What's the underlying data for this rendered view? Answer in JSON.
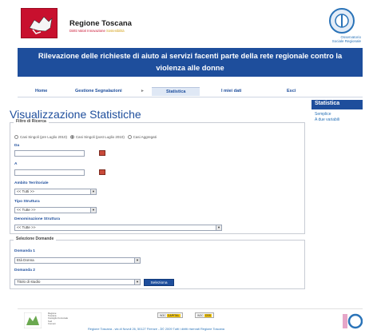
{
  "header": {
    "org_name": "Regione Toscana",
    "org_sub_a": "Diritti Valori Innovazione",
    "org_sub_b": "Sostenibilità",
    "osservatorio_1": "Osservatorio",
    "osservatorio_2": "Sociale Regionale"
  },
  "banner": {
    "line1": "Rilevazione delle richieste di aiuto ai servizi facenti parte della rete regionale contro la",
    "line2": "violenza alle donne"
  },
  "nav": {
    "home": "Home",
    "gestione": "Gestione Segnalazioni",
    "gestione_arrow": "▸",
    "statistica": "Statistica",
    "miei_dati": "I miei dati",
    "esci": "Esci"
  },
  "page": {
    "title": "Visualizzazione Statistiche"
  },
  "filtro": {
    "legend": "Filtro di Ricerca",
    "radio_1": "Casi Singoli (pre Luglio 2010)",
    "radio_2": "Casi Singoli (post Luglio 2010)",
    "radio_3": "Casi Aggregati",
    "da_label": "Da",
    "a_label": "A",
    "ambito_label": "Ambito Territoriale",
    "ambito_value": "<< Tutti >>",
    "tipo_label": "Tipo Struttura",
    "tipo_value": "<< Tutte >>",
    "denom_label": "Denominazione Struttura",
    "denom_value": "<< Tutte >>"
  },
  "selezione": {
    "legend": "Selezione Domande",
    "d1_label": "Domanda 1",
    "d1_value": "Età Donna",
    "d2_label": "Domanda 2",
    "d2_value": "Titolo di studio",
    "button": "Seleziona"
  },
  "sidebar": {
    "heading": "Statistica",
    "link_1": "Semplice",
    "link_2": "A due variabili"
  },
  "footer": {
    "logo_l1": "Regione",
    "logo_l2": "Toscana",
    "logo_l3": "Consiglio Comunale",
    "logo_l4": "Sud",
    "logo_l5": "Comuni",
    "badge_1": "CAPITAL",
    "badge_1_prefix": "W3C",
    "badge_2": "CSS",
    "badge_2_prefix": "W3C",
    "text": "Regione Toscana - via di Novoli 26, 50127 Firenze - Â© 2009 Tutti i diritti riservati Regione Toscana"
  },
  "colors": {
    "primary": "#1e4e9c",
    "brand_red": "#c8102e",
    "link": "#2a73b8"
  }
}
